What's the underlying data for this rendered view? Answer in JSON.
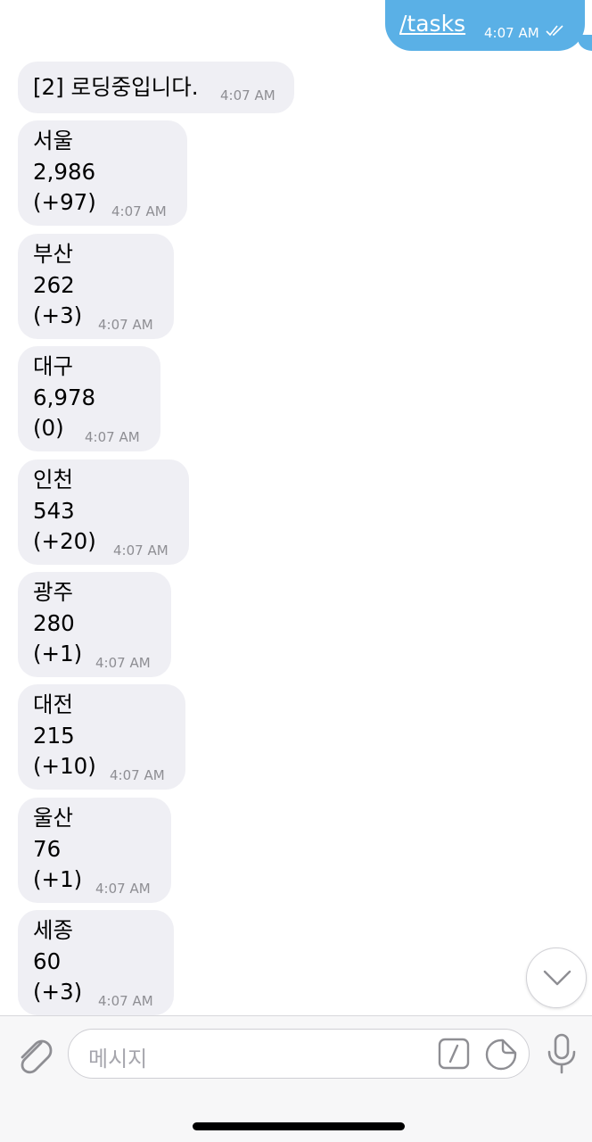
{
  "outgoing": {
    "text": "/tasks",
    "time": "4:07 AM"
  },
  "loading_message": {
    "text": "[2] 로딩중입니다.",
    "time": "4:07 AM"
  },
  "regions": [
    {
      "name": "서울",
      "total": "2,986",
      "change": "(+97)",
      "time": "4:07 AM"
    },
    {
      "name": "부산",
      "total": "262",
      "change": "(+3)",
      "time": "4:07 AM"
    },
    {
      "name": "대구",
      "total": "6,978",
      "change": "(0)",
      "time": "4:07 AM"
    },
    {
      "name": "인천",
      "total": "543",
      "change": "(+20)",
      "time": "4:07 AM"
    },
    {
      "name": "광주",
      "total": "280",
      "change": "(+1)",
      "time": "4:07 AM"
    },
    {
      "name": "대전",
      "total": "215",
      "change": "(+10)",
      "time": "4:07 AM"
    },
    {
      "name": "울산",
      "total": "76",
      "change": "(+1)",
      "time": "4:07 AM"
    },
    {
      "name": "세종",
      "total": "60",
      "change": "(+3)",
      "time": "4:07 AM"
    }
  ],
  "composer": {
    "placeholder": "메시지"
  },
  "icons": {
    "attach": "paperclip-icon",
    "commands": "slash-command-icon",
    "sticker": "sticker-icon",
    "mic": "microphone-icon",
    "scroll": "chevron-down-icon",
    "read": "double-check-icon"
  },
  "colors": {
    "outgoing_bubble": "#5ab0e6",
    "incoming_bubble": "#efeff4"
  }
}
